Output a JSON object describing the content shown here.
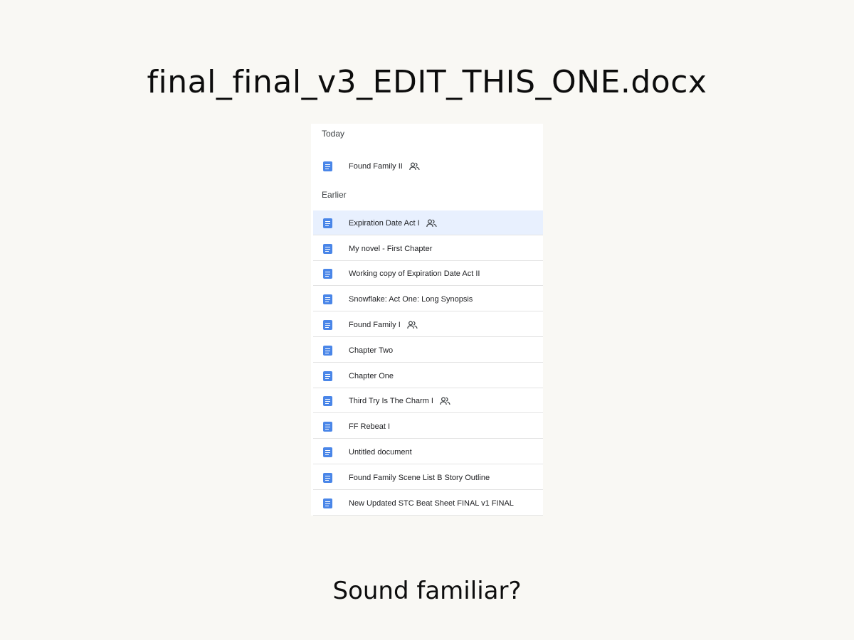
{
  "headline": "final_final_v3_EDIT_THIS_ONE.docx",
  "footer": "Sound familiar?",
  "file_list": {
    "today_label": "Today",
    "earlier_label": "Earlier",
    "today_items": [
      {
        "title": "Found Family II",
        "shared": true,
        "icon": "google-docs-icon"
      }
    ],
    "earlier_items": [
      {
        "title": "Expiration Date Act I",
        "shared": true,
        "selected": true,
        "icon": "google-docs-icon"
      },
      {
        "title": "My novel - First Chapter",
        "shared": false,
        "icon": "google-docs-icon"
      },
      {
        "title": "Working copy of Expiration Date Act II",
        "shared": false,
        "icon": "google-docs-icon"
      },
      {
        "title": "Snowflake: Act One: Long Synopsis",
        "shared": false,
        "icon": "google-docs-icon"
      },
      {
        "title": "Found Family I",
        "shared": true,
        "icon": "google-docs-icon"
      },
      {
        "title": "Chapter Two",
        "shared": false,
        "icon": "google-docs-icon"
      },
      {
        "title": "Chapter One",
        "shared": false,
        "icon": "google-docs-icon"
      },
      {
        "title": "Third Try Is The Charm I",
        "shared": true,
        "icon": "google-docs-icon"
      },
      {
        "title": "FF Rebeat I",
        "shared": false,
        "icon": "google-docs-icon"
      },
      {
        "title": "Untitled document",
        "shared": false,
        "icon": "google-docs-icon"
      },
      {
        "title": "Found Family Scene List B Story Outline",
        "shared": false,
        "icon": "google-docs-icon"
      },
      {
        "title": "New Updated STC Beat Sheet FINAL v1 FINAL",
        "shared": false,
        "icon": "google-docs-icon"
      }
    ]
  },
  "colors": {
    "background": "#f9f8f4",
    "doc_icon": "#4a86e8",
    "selected_row": "#e8f0fe"
  }
}
